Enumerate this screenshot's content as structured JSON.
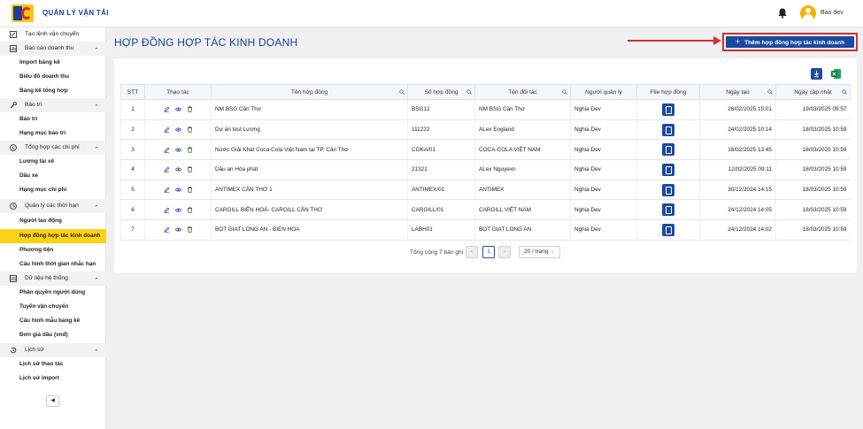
{
  "app": {
    "brand": "QUẢN LÝ VẬN TẢI",
    "user": "Bao dev"
  },
  "sidebar": {
    "top_item": "Tạo lệnh vận chuyển",
    "groups": [
      {
        "label": "Báo cáo doanh thu",
        "icon": "report-icon",
        "items": [
          "Import bảng kê",
          "Biểu đồ doanh thu",
          "Bảng kê tổng hợp"
        ]
      },
      {
        "label": "Bảo trì",
        "icon": "wrench-icon",
        "items": [
          "Báo trì",
          "Hạng mục bảo trì"
        ]
      },
      {
        "label": "Tổng hợp các chi phí",
        "icon": "money-icon",
        "items": [
          "Lương tài xế",
          "Dầu xe",
          "Hạng mục chi phí"
        ]
      },
      {
        "label": "Quản lý các thời hạn",
        "icon": "clock-icon",
        "items": [
          "Người lao động",
          "Hợp đồng hợp tác kinh doanh",
          "Phương tiện",
          "Cấu hình thời gian nhắc hạn"
        ]
      },
      {
        "label": "Dữ liệu hệ thống",
        "icon": "database-icon",
        "items": [
          "Phân quyền người dùng",
          "Tuyến vận chuyển",
          "Cấu hình mẫu bảng kê",
          "Đơn giá dầu (vnđ)"
        ]
      },
      {
        "label": "Lịch sử",
        "icon": "history-icon",
        "items": [
          "Lịch sử thao tác",
          "Lịch sử import"
        ]
      }
    ],
    "active_item": "Hợp đồng hợp tác kinh doanh"
  },
  "page": {
    "title": "HỢP ĐỒNG HỢP TÁC KINH DOANH",
    "add_button": "Thêm hợp đồng hợp tác kinh doanh"
  },
  "table": {
    "columns": [
      "STT",
      "Thao tác",
      "Tên hợp đồng",
      "Số hợp đồng",
      "Tên đối tác",
      "Người quản lý",
      "File hợp đồng",
      "Ngày tạo",
      "Ngày cập nhật"
    ],
    "rows": [
      {
        "stt": "1",
        "name": "NM BSG Cần Thơ",
        "number": "BSG12",
        "partner": "NM BSG Cần Thơ",
        "manager": "Nghia Dev",
        "created": "26/02/2025 15:01",
        "updated": "19/03/2025 09:57"
      },
      {
        "stt": "2",
        "name": "Dự án test Lương",
        "number": "111222",
        "partner": "ALex England",
        "manager": "Nghia Dev",
        "created": "24/02/2025 10:14",
        "updated": "18/03/2025 10:59"
      },
      {
        "stt": "3",
        "name": "Nước Giải Khát Coca-Cola Việt Nam tại TP. Cần Thơ",
        "number": "COKA/01",
        "partner": "COCA-COLA VIỆT NAM",
        "manager": "Nghia Dev",
        "created": "18/02/2025 13:45",
        "updated": "18/03/2025 10:59"
      },
      {
        "stt": "4",
        "name": "Dầu an Hòa phát",
        "number": "21321",
        "partner": "ALex Nguyexn",
        "manager": "Nghia Dev",
        "created": "12/02/2025 09:11",
        "updated": "18/03/2025 10:59"
      },
      {
        "stt": "5",
        "name": "ANTIMEX CẦN THƠ 1",
        "number": "ANTIMEX/01",
        "partner": "ANTIMEX",
        "manager": "Nghia Dev",
        "created": "30/12/2024 14:15",
        "updated": "18/03/2025 10:59"
      },
      {
        "stt": "6",
        "name": "CARGILL BIÊN HOÀ- CARGILL CẦN THƠ",
        "number": "CARGILL/01",
        "partner": "CARGILL VIỆT NAM",
        "manager": "Nghia Dev",
        "created": "24/12/2024 14:05",
        "updated": "18/03/2025 10:59"
      },
      {
        "stt": "7",
        "name": "BOT GIAT LONG AN - BIEN HOA",
        "number": "LABH01",
        "partner": "BOT GIAT LONG AN",
        "manager": "Nghia Dev",
        "created": "24/12/2024 14:02",
        "updated": "18/03/2025 10:59"
      }
    ]
  },
  "pagination": {
    "total_text": "Tổng cộng 7 bản ghi",
    "current_page": "1",
    "page_size": "20 / trang"
  },
  "colors": {
    "primary": "#1c4a9e",
    "active_menu": "#fcd116",
    "highlight": "#d32f2f"
  }
}
